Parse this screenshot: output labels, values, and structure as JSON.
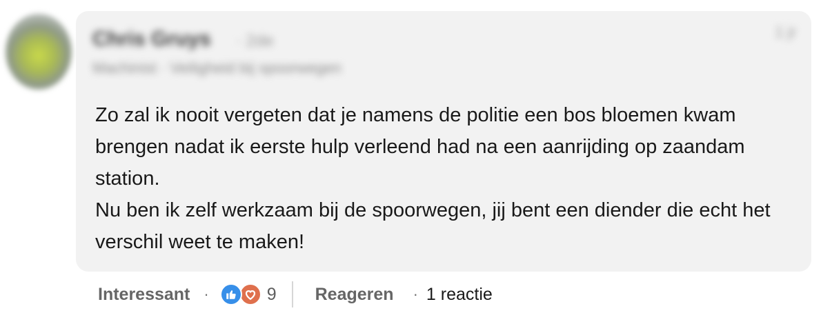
{
  "comment": {
    "author_name": "Chris Gruys",
    "degree": "· 2de",
    "headline": "Machinist · Veiligheid bij spoorwegen",
    "timestamp": "1 jr",
    "text_paragraph_1": "Zo zal ik nooit vergeten dat je namens de politie een bos bloemen kwam brengen nadat ik eerste hulp verleend had na een aanrijding op zaandam station.",
    "text_paragraph_2": "Nu ben ik zelf werkzaam bij de spoorwegen, jij bent een diender die echt het verschil weet te maken!"
  },
  "actions": {
    "react_label": "Interessant",
    "separator": "·",
    "reaction_count": "9",
    "reply_label": "Reageren",
    "reply_count_label": "1 reactie"
  },
  "icons": {
    "like": "thumbs-up-icon",
    "love": "heart-icon"
  },
  "colors": {
    "bubble_bg": "#f2f2f2",
    "like_blue": "#378fe9",
    "love_orange": "#df704d"
  }
}
